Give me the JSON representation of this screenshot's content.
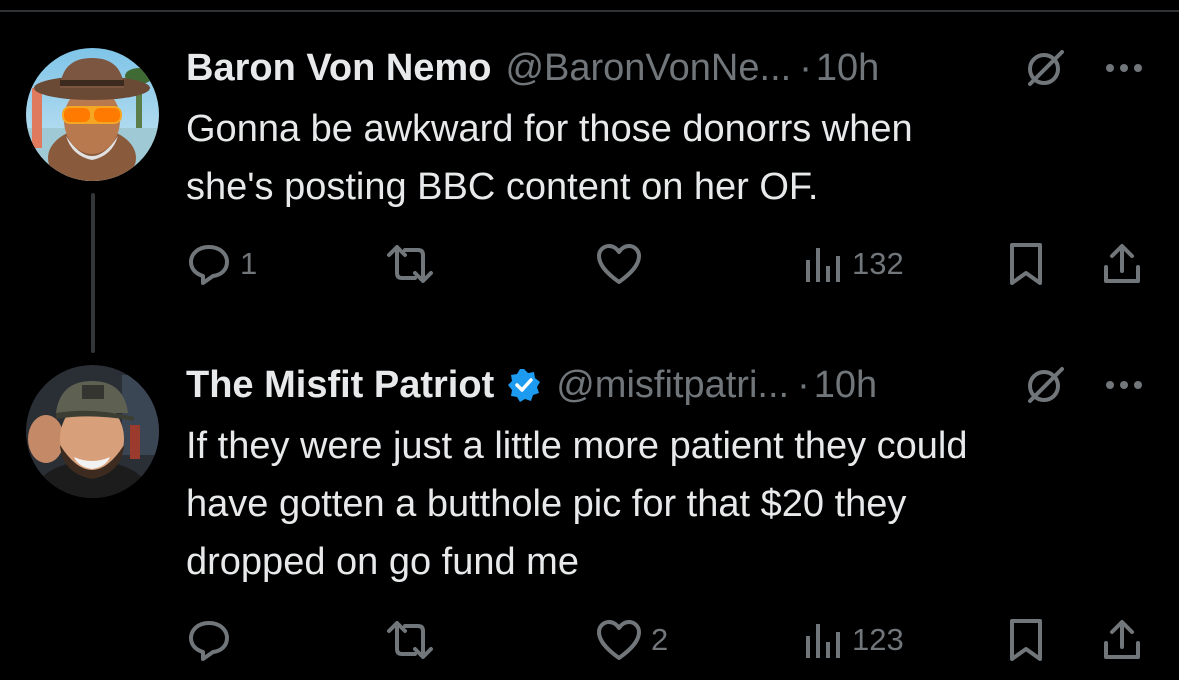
{
  "tweets": [
    {
      "display_name": "Baron Von Nemo",
      "handle": "@BaronVonNe...",
      "separator": "·",
      "time": "10h",
      "verified": false,
      "avatar": "avatar-cowboy-hat-sunglasses",
      "text": "Gonna be awkward for those donorrs when\nshe's posting BBC content on her OF.",
      "replies": "1",
      "retweets": "",
      "likes": "",
      "views": "132"
    },
    {
      "display_name": "The Misfit Patriot",
      "handle": "@misfitpatri...",
      "separator": "·",
      "time": "10h",
      "verified": true,
      "avatar": "avatar-bearded-man-cap",
      "text": "If they were just a little more patient they could\nhave gotten a butthole pic for that $20 they\ndropped on go fund me",
      "replies": "",
      "retweets": "",
      "likes": "2",
      "views": "123"
    }
  ],
  "colors": {
    "background": "#000000",
    "primary_text": "#e7e9ea",
    "secondary_text": "#71767b",
    "verified_blue": "#1d9bf0",
    "divider": "#2f3336"
  },
  "icons": [
    "reply-icon",
    "retweet-icon",
    "like-icon",
    "views-icon",
    "bookmark-icon",
    "share-icon",
    "grok-icon",
    "more-icon",
    "verified-badge-icon"
  ]
}
